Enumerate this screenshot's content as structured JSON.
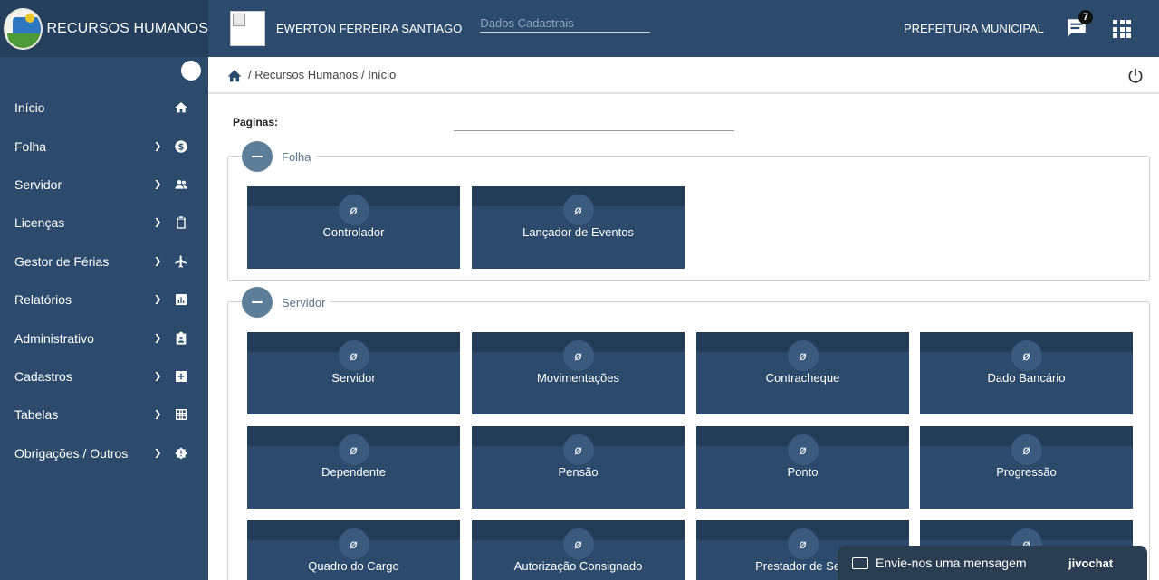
{
  "sidebar": {
    "brand_title": "RECURSOS HUMANOS",
    "items": [
      {
        "label": "Início",
        "icon": "home-icon"
      },
      {
        "label": "Folha",
        "icon": "dollar-icon"
      },
      {
        "label": "Servidor",
        "icon": "people-icon"
      },
      {
        "label": "Licenças",
        "icon": "clipboard-icon"
      },
      {
        "label": "Gestor de Férias",
        "icon": "airplane-icon"
      },
      {
        "label": "Relatórios",
        "icon": "chart-icon"
      },
      {
        "label": "Administrativo",
        "icon": "badge-icon"
      },
      {
        "label": "Cadastros",
        "icon": "plus-box-icon"
      },
      {
        "label": "Tabelas",
        "icon": "grid-icon"
      },
      {
        "label": "Obrigações / Outros",
        "icon": "alert-icon"
      }
    ]
  },
  "topbar": {
    "user_name": "EWERTON FERREIRA SANTIAGO",
    "dados_placeholder": "Dados Cadastrais",
    "org": "PREFEITURA MUNICIPAL",
    "chat_badge": "7"
  },
  "breadcrumb": {
    "text": "/ Recursos Humanos / Início"
  },
  "main": {
    "paginas_label": "Paginas:",
    "sections": [
      {
        "title": "Folha",
        "cards": [
          "Controlador",
          "Lançador de Eventos"
        ]
      },
      {
        "title": "Servidor",
        "cards": [
          "Servidor",
          "Movimentações",
          "Contracheque",
          "Dado Bancário",
          "Dependente",
          "Pensão",
          "Ponto",
          "Progressão",
          "Quadro do Cargo",
          "Autorização Consignado",
          "Prestador de Serv",
          ""
        ]
      }
    ]
  },
  "chat_widget": {
    "message": "Envie-nos uma mensagem",
    "brand": "jivochat"
  },
  "colors": {
    "primary": "#2c4a6b",
    "dark": "#233c58",
    "accent": "#5c7e99"
  }
}
